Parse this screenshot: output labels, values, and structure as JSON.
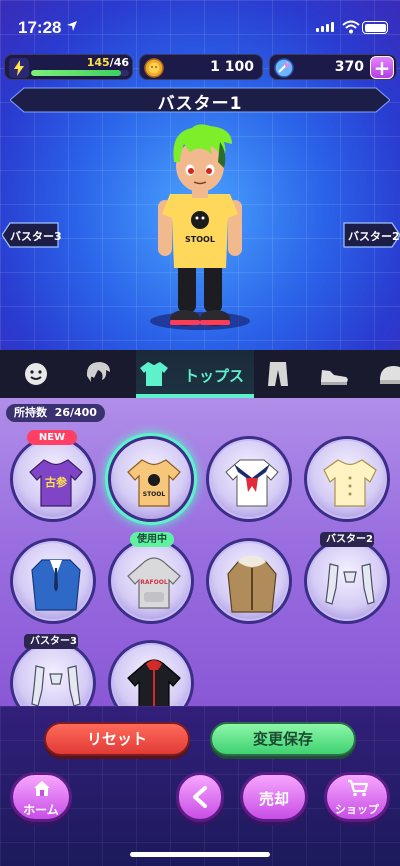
{
  "status_bar": {
    "time": "17:28"
  },
  "resources": {
    "energy": {
      "current": "145",
      "separator": "/",
      "max": "46",
      "fill_fraction": 0.92
    },
    "coins": "1 100",
    "gems": "370",
    "plus_label": "+"
  },
  "character": {
    "title": "バスター1",
    "prev_label": "バスター3",
    "next_label": "バスター2",
    "shirt_text": "STOOL"
  },
  "tabs": {
    "active_label": "トップス",
    "icons": [
      "face-icon",
      "hair-icon",
      "shirt-icon",
      "pants-icon",
      "shoes-icon",
      "hat-icon"
    ]
  },
  "inventory": {
    "count_label": "所持数",
    "count_value": "26/400",
    "items": [
      {
        "name": "purple-kanji-shirt",
        "badge": "NEW",
        "shirt_text": "古参"
      },
      {
        "name": "yellow-ghost-shirt",
        "badge": "",
        "selected": true,
        "shirt_text": "STOOL"
      },
      {
        "name": "sailor-shirt",
        "badge": ""
      },
      {
        "name": "cream-blouse",
        "badge": ""
      },
      {
        "name": "blue-suit",
        "badge": ""
      },
      {
        "name": "grey-hoodie",
        "badge": "使用中",
        "shirt_text": "RAFOOL"
      },
      {
        "name": "fur-parka",
        "badge": ""
      },
      {
        "name": "robot-arms-2",
        "badge": "バスター2"
      },
      {
        "name": "robot-arms-3",
        "badge": "バスター3"
      },
      {
        "name": "black-red-jacket",
        "badge": ""
      }
    ]
  },
  "actions": {
    "reset_label": "リセット",
    "save_label": "変更保存"
  },
  "nav": {
    "home_label": "ホーム",
    "back_label": "<",
    "sell_label": "売却",
    "shop_label": "ショップ"
  },
  "colors": {
    "accent": "#5ef2cc",
    "new_badge": "#ff3f63",
    "reset": "#e13b36",
    "save": "#3fd171",
    "nav": "#c84ee6"
  }
}
